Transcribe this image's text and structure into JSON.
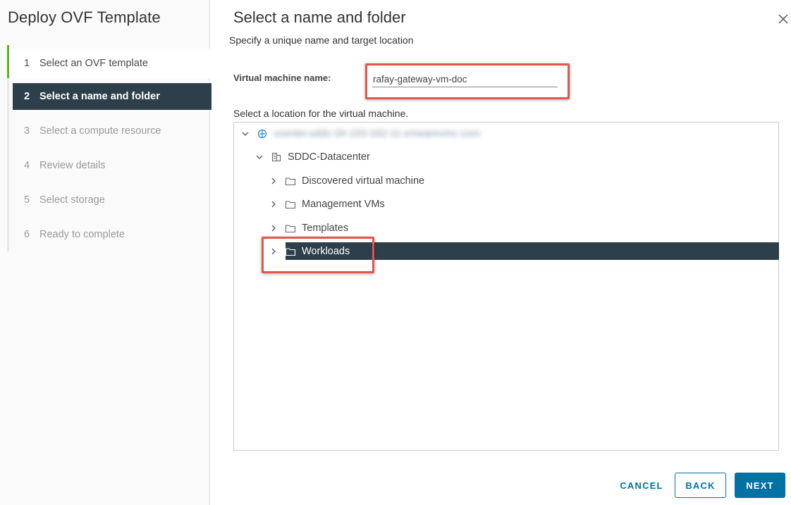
{
  "wizard": {
    "title": "Deploy OVF Template",
    "steps": [
      {
        "num": "1",
        "label": "Select an OVF template",
        "state": "done"
      },
      {
        "num": "2",
        "label": "Select a name and folder",
        "state": "current"
      },
      {
        "num": "3",
        "label": "Select a compute resource",
        "state": "pending"
      },
      {
        "num": "4",
        "label": "Review details",
        "state": "pending"
      },
      {
        "num": "5",
        "label": "Select storage",
        "state": "pending"
      },
      {
        "num": "6",
        "label": "Ready to complete",
        "state": "pending"
      }
    ]
  },
  "page": {
    "title": "Select a name and folder",
    "subtitle": "Specify a unique name and target location"
  },
  "form": {
    "vm_name_label": "Virtual machine name:",
    "vm_name_value": "rafay-gateway-vm-doc",
    "location_label": "Select a location for the virtual machine."
  },
  "tree": {
    "root": {
      "label": "vcenter.sddc-34-193-162-11.vmwarevmc.com",
      "icon": "vcenter-icon",
      "blurred": true
    },
    "datacenter": {
      "label": "SDDC-Datacenter",
      "icon": "datacenter-icon"
    },
    "folders": [
      {
        "label": "Discovered virtual machine",
        "icon": "folder-icon",
        "selected": false
      },
      {
        "label": "Management VMs",
        "icon": "folder-icon",
        "selected": false
      },
      {
        "label": "Templates",
        "icon": "folder-icon",
        "selected": false
      },
      {
        "label": "Workloads",
        "icon": "folder-icon",
        "selected": true
      }
    ]
  },
  "footer": {
    "cancel_label": "CANCEL",
    "back_label": "BACK",
    "next_label": "NEXT"
  },
  "colors": {
    "accent": "#0072a3",
    "selected_bg": "#2e3f4c",
    "step_done": "#60b515",
    "highlight": "#e2564b"
  }
}
